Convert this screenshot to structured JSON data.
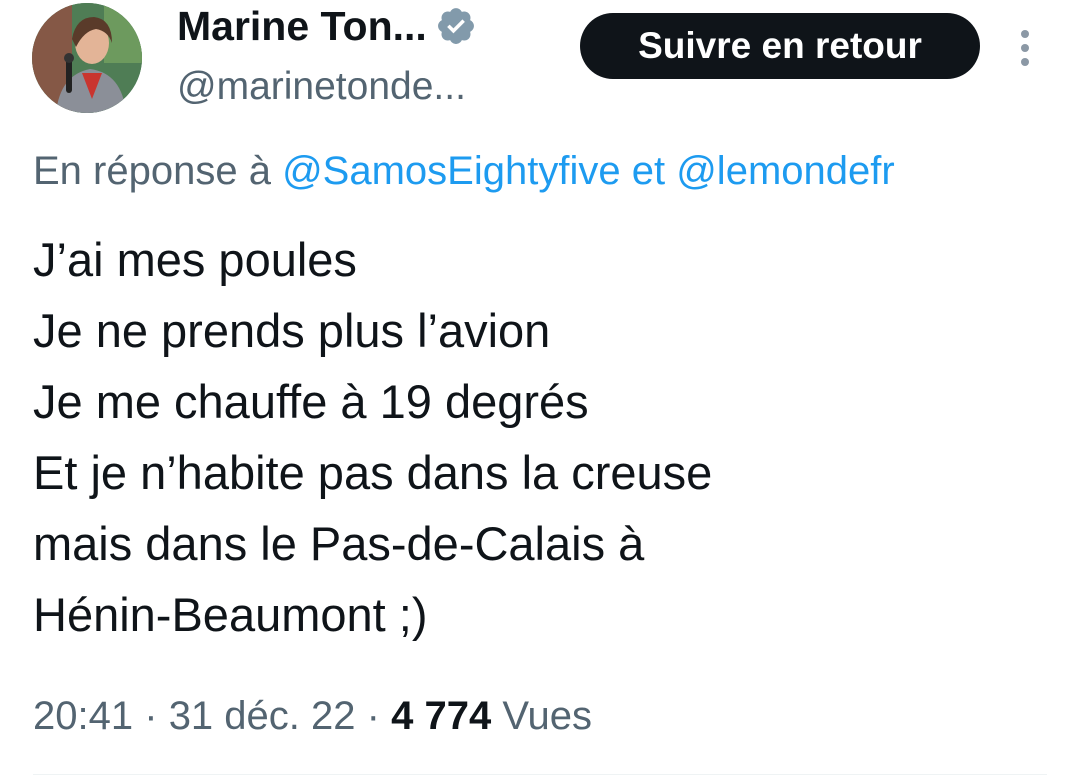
{
  "author": {
    "display_name": "Marine Ton...",
    "handle": "@marinetonde...",
    "verified_icon": "verified-badge-icon",
    "avatar_icon": "avatar-photo"
  },
  "actions": {
    "follow_label": "Suivre en retour",
    "more_icon": "more-vertical-icon"
  },
  "reply": {
    "prefix": "En réponse à",
    "mentions": [
      "@SamosEightyfive",
      "@lemondefr"
    ],
    "conjunction": "et"
  },
  "tweet": {
    "lines": [
      "J’ai mes poules",
      "Je ne prends plus l’avion",
      "Je me chauffe à 19 degrés",
      "Et je n’habite pas dans la creuse",
      "mais dans le Pas-de-Calais à",
      "Hénin-Beaumont ;)"
    ]
  },
  "meta": {
    "time": "20:41",
    "separator": "·",
    "date": "31 déc. 22",
    "views_count": "4 774",
    "views_label": "Vues"
  },
  "colors": {
    "text": "#0f1419",
    "secondary": "#536471",
    "link": "#1d9bf0",
    "button_bg": "#0f1419",
    "verified": "#829aab"
  }
}
